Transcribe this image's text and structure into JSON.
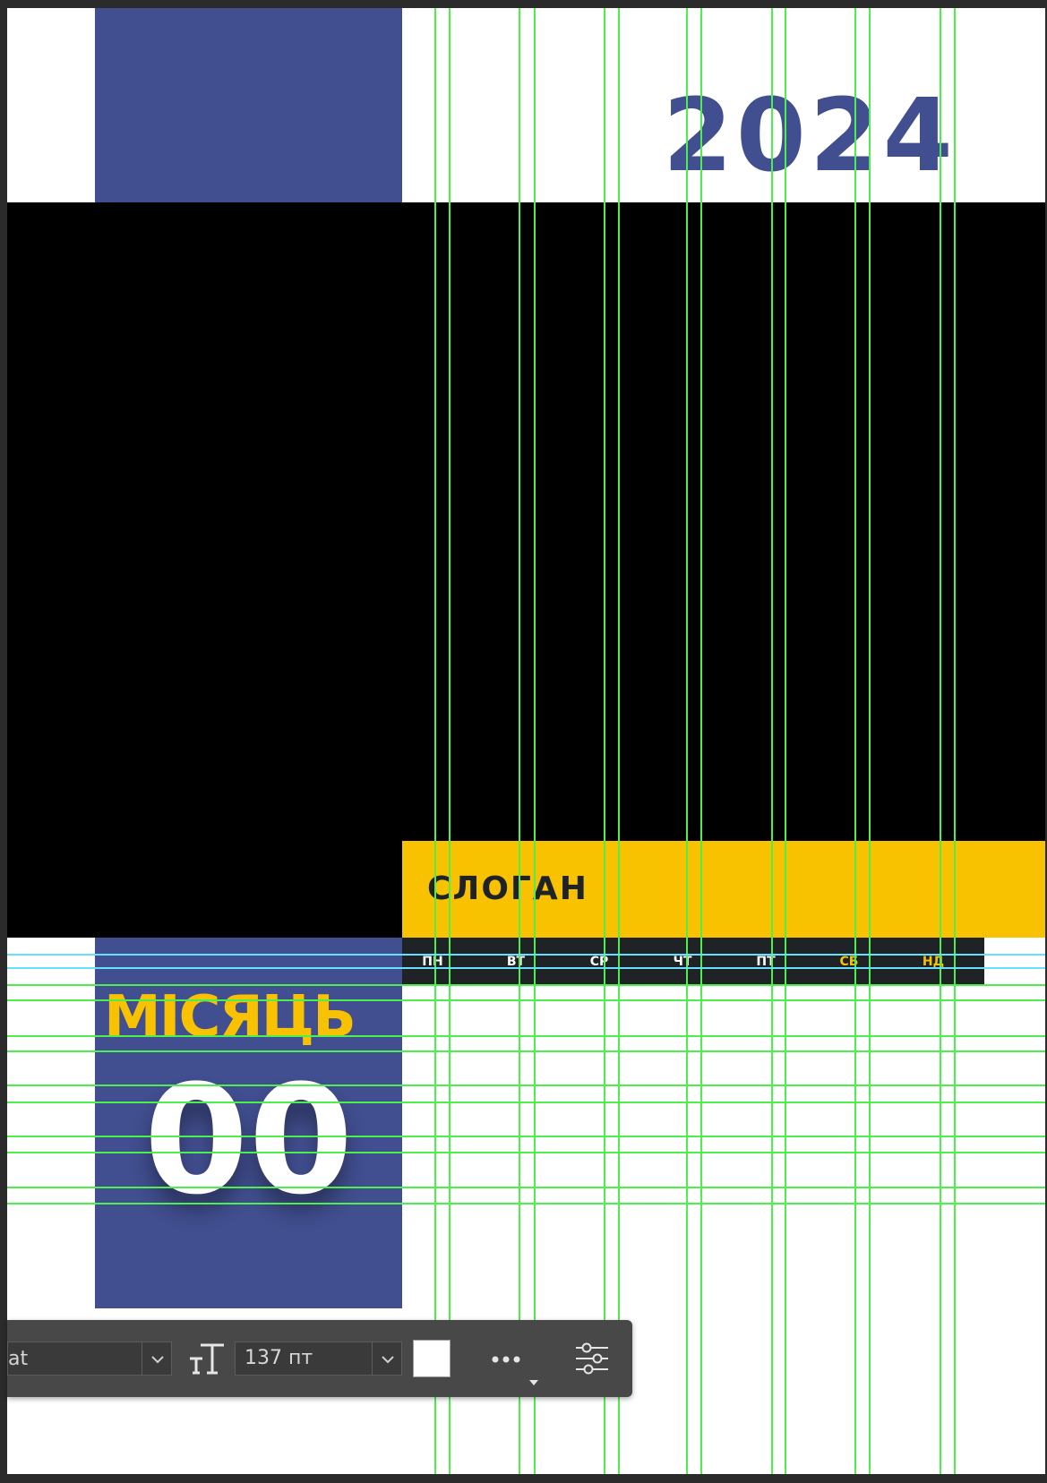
{
  "poster": {
    "year": "2024",
    "slogan": "СЛОГАН",
    "month": "МІСЯЦЬ",
    "number": "00",
    "weekdays": [
      "ПН",
      "ВТ",
      "СР",
      "ЧТ",
      "ПТ",
      "СБ",
      "НД"
    ],
    "weekend_days": [
      "СБ",
      "НД"
    ]
  },
  "colors": {
    "accent_blue": "#414e8f",
    "accent_yellow": "#f9c200",
    "dark_bar": "#1f2326",
    "guide_green": "#4cef4c",
    "guide_cyan": "#66e0ff",
    "toolbar_bg": "#484848"
  },
  "toolbar": {
    "font_family_value": "at",
    "font_size_value": "137 пт",
    "text_color": "#ffffff",
    "icons": {
      "font_family_dropdown": "chevron-down-icon",
      "font_size": "text-size-icon",
      "font_size_dropdown": "chevron-down-icon",
      "more": "more-options-icon",
      "settings": "sliders-icon"
    }
  }
}
